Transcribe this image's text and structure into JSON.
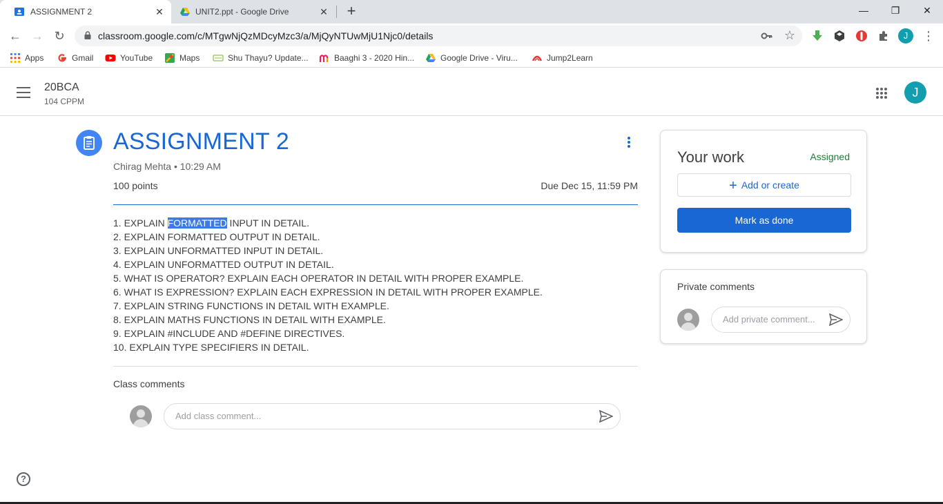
{
  "browser": {
    "tabs": [
      {
        "title": "ASSIGNMENT 2",
        "active": true
      },
      {
        "title": "UNIT2.ppt - Google Drive",
        "active": false
      }
    ],
    "tab_close_glyph": "✕",
    "new_tab_glyph": "+",
    "window_controls": {
      "minimize": "—",
      "maximize": "❐",
      "close": "✕"
    },
    "nav": {
      "back": "←",
      "forward": "→",
      "reload": "↻"
    },
    "url": "classroom.google.com/c/MTgwNjQzMDcyMzc3/a/MjQyNTUwMjU1Njc0/details",
    "star_glyph": "☆",
    "menu_glyph": "⋮",
    "profile_initial": "J",
    "bookmarks": [
      {
        "label": "Apps",
        "icon": "apps-grid-icon"
      },
      {
        "label": "Gmail",
        "icon": "google-g-icon"
      },
      {
        "label": "YouTube",
        "icon": "youtube-icon"
      },
      {
        "label": "Maps",
        "icon": "maps-icon"
      },
      {
        "label": "Shu Thayu? Update...",
        "icon": "news-icon"
      },
      {
        "label": "Baaghi 3 - 2020 Hin...",
        "icon": "m-logo-icon"
      },
      {
        "label": "Google Drive - Viru...",
        "icon": "drive-icon"
      },
      {
        "label": "Jump2Learn",
        "icon": "jump2learn-icon"
      }
    ]
  },
  "classroom": {
    "class_name": "20BCA",
    "section": "104 CPPM",
    "account_initial": "J"
  },
  "assignment": {
    "title": "ASSIGNMENT 2",
    "author": "Chirag Mehta",
    "separator": "•",
    "time": "10:29 AM",
    "points": "100 points",
    "due": "Due Dec 15, 11:59 PM",
    "instructions": [
      {
        "before": "1. EXPLAIN ",
        "highlight": "FORMATTED",
        "after": " INPUT IN DETAIL."
      },
      {
        "text": "2. EXPLAIN FORMATTED OUTPUT IN DETAIL."
      },
      {
        "text": "3. EXPLAIN UNFORMATTED INPUT IN DETAIL."
      },
      {
        "text": "4. EXPLAIN UNFORMATTED OUTPUT IN DETAIL."
      },
      {
        "text": "5. WHAT IS OPERATOR? EXPLAIN EACH OPERATOR IN DETAIL WITH PROPER EXAMPLE."
      },
      {
        "text": "6. WHAT IS EXPRESSION? EXPLAIN EACH EXPRESSION IN DETAIL WITH PROPER EXAMPLE."
      },
      {
        "text": "7. EXPLAIN STRING FUNCTIONS IN DETAIL WITH EXAMPLE."
      },
      {
        "text": "8. EXPLAIN MATHS FUNCTIONS IN DETAIL WITH EXAMPLE."
      },
      {
        "text": "9. EXPLAIN #INCLUDE AND #DEFINE DIRECTIVES."
      },
      {
        "text": "10. EXPLAIN TYPE SPECIFIERS IN DETAIL."
      }
    ],
    "class_comments_label": "Class comments",
    "class_comment_placeholder": "Add class comment..."
  },
  "your_work": {
    "title": "Your work",
    "status": "Assigned",
    "add_or_create": "Add or create",
    "add_glyph": "+",
    "mark_as_done": "Mark as done"
  },
  "private_comments": {
    "title": "Private comments",
    "placeholder": "Add private comment..."
  },
  "help_glyph": "?",
  "colors": {
    "accent": "#1967d2",
    "assigned_status": "#188038",
    "avatar": "#129eaf",
    "highlight": "#3a7be4"
  }
}
